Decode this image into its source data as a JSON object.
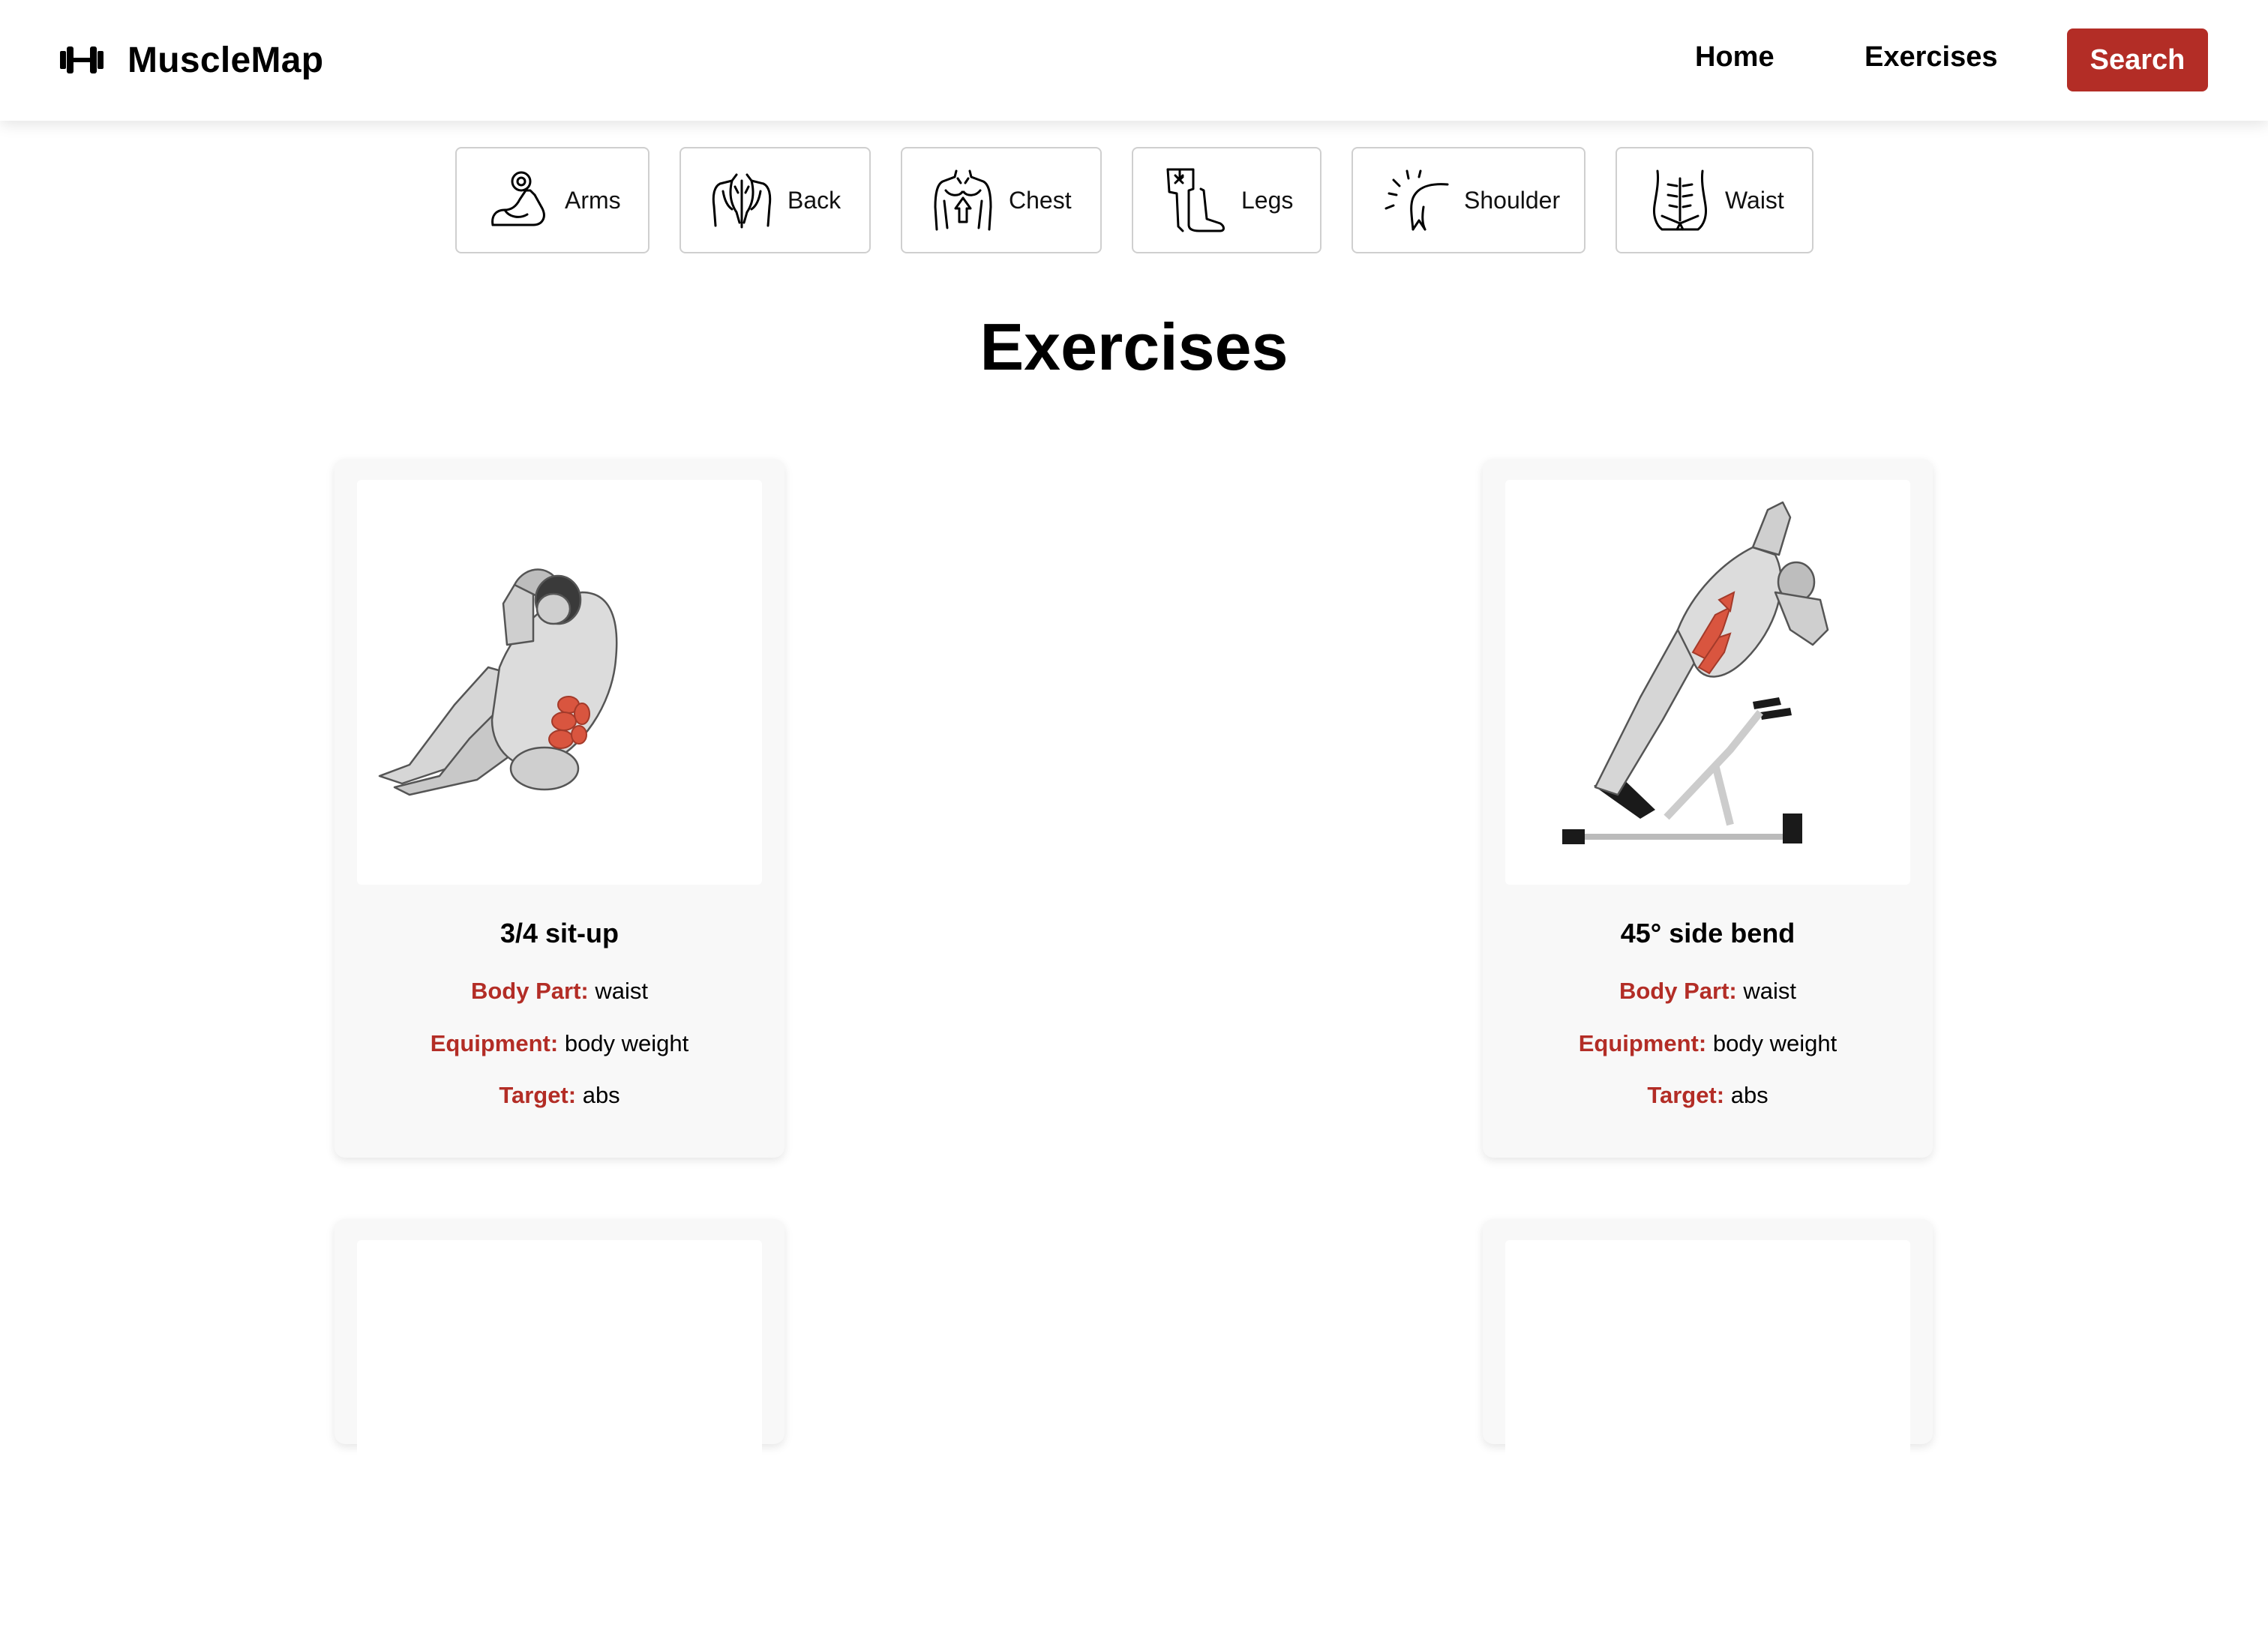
{
  "header": {
    "brand": "MuscleMap",
    "brand_icon": "dumbbell-icon",
    "nav": {
      "home": "Home",
      "exercises": "Exercises",
      "search": "Search"
    }
  },
  "categories": [
    {
      "label": "Arms",
      "icon": "arm-icon"
    },
    {
      "label": "Back",
      "icon": "back-icon"
    },
    {
      "label": "Chest",
      "icon": "chest-icon"
    },
    {
      "label": "Legs",
      "icon": "legs-icon"
    },
    {
      "label": "Shoulder",
      "icon": "shoulder-icon"
    },
    {
      "label": "Waist",
      "icon": "waist-icon"
    }
  ],
  "main": {
    "heading": "Exercises"
  },
  "labels": {
    "body_part": "Body Part:",
    "equipment": "Equipment:",
    "target": "Target:"
  },
  "exercises": [
    {
      "name": "3/4 sit-up",
      "body_part": "waist",
      "equipment": "body weight",
      "target": "abs"
    },
    {
      "name": "45° side bend",
      "body_part": "waist",
      "equipment": "body weight",
      "target": "abs"
    }
  ],
  "colors": {
    "accent": "#b32d26",
    "highlight_muscle": "#d9553f"
  }
}
